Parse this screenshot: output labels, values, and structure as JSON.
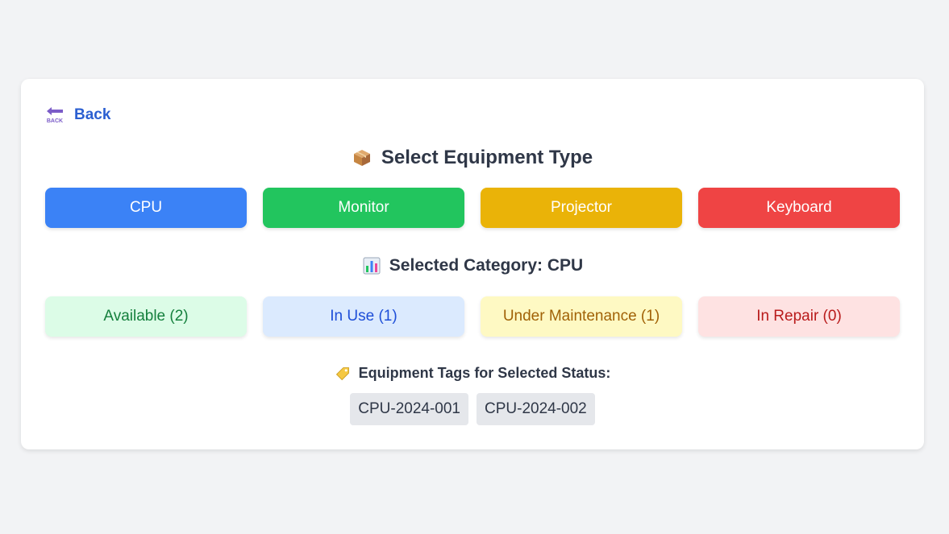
{
  "back": {
    "label": "Back",
    "icon": "back-arrow-icon"
  },
  "header": {
    "title": "Select Equipment Type",
    "icon": "package-icon"
  },
  "equipment_types": [
    {
      "label": "CPU",
      "color": "#3b82f6"
    },
    {
      "label": "Monitor",
      "color": "#22c55e"
    },
    {
      "label": "Projector",
      "color": "#eab308"
    },
    {
      "label": "Keyboard",
      "color": "#ef4444"
    }
  ],
  "selected": {
    "label": "Selected Category: CPU",
    "icon": "bar-chart-icon"
  },
  "statuses": [
    {
      "label": "Available (2)",
      "bg": "#dcfce7",
      "fg": "#15803d"
    },
    {
      "label": "In Use (1)",
      "bg": "#dbeafe",
      "fg": "#1d4ed8"
    },
    {
      "label": "Under Maintenance (1)",
      "bg": "#fef9c3",
      "fg": "#a16207"
    },
    {
      "label": "In Repair (0)",
      "bg": "#fee2e2",
      "fg": "#b91c1c"
    }
  ],
  "tags_section": {
    "label": "Equipment Tags for Selected Status:",
    "icon": "label-tag-icon",
    "tags": [
      "CPU-2024-001",
      "CPU-2024-002"
    ]
  }
}
